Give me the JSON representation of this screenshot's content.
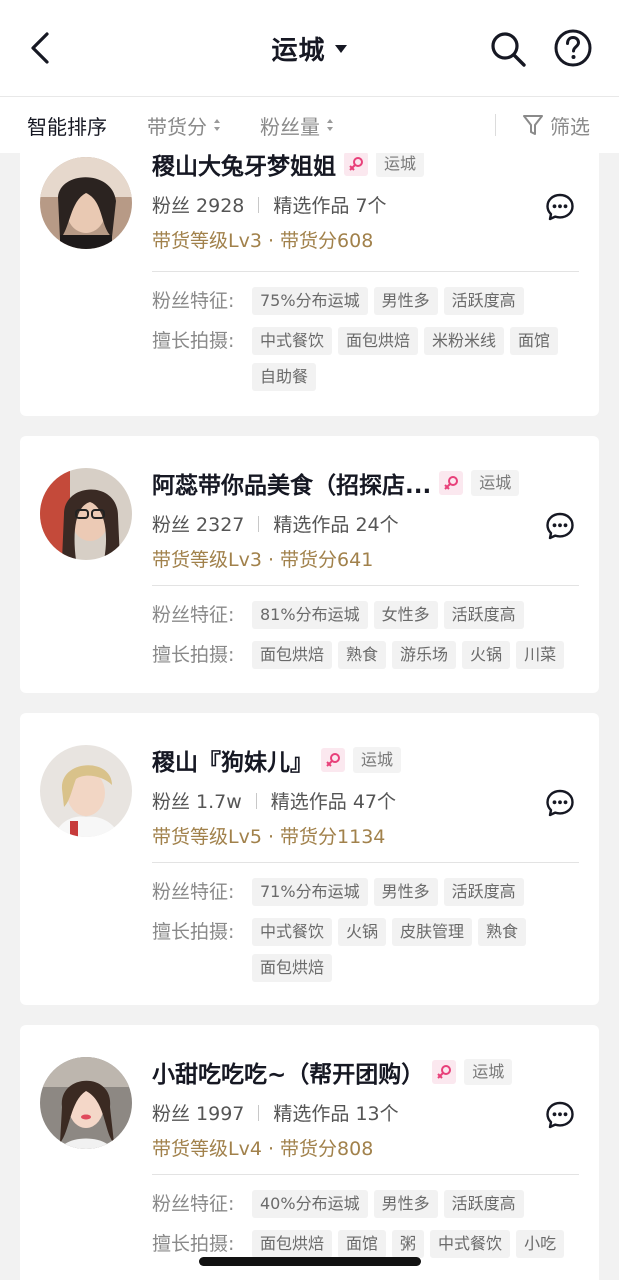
{
  "header": {
    "title": "运城"
  },
  "sortbar": {
    "smart": "智能排序",
    "goods_score": "带货分",
    "fans_count": "粉丝量",
    "filter": "筛选"
  },
  "cards": [
    {
      "name": "稷山大兔牙梦姐姐",
      "city": "运城",
      "fans": "粉丝 2928",
      "works": "精选作品 7个",
      "level": "带货等级Lv3 · 带货分608",
      "fans_label": "粉丝特征:",
      "fans_tags": [
        "75%分布运城",
        "男性多",
        "活跃度高"
      ],
      "skill_label": "擅长拍摄:",
      "skill_tags": [
        "中式餐饮",
        "面包烘焙",
        "米粉米线",
        "面馆",
        "自助餐"
      ]
    },
    {
      "name": "阿蕊带你品美食（招探店...",
      "city": "运城",
      "fans": "粉丝 2327",
      "works": "精选作品 24个",
      "level": "带货等级Lv3 · 带货分641",
      "fans_label": "粉丝特征:",
      "fans_tags": [
        "81%分布运城",
        "女性多",
        "活跃度高"
      ],
      "skill_label": "擅长拍摄:",
      "skill_tags": [
        "面包烘焙",
        "熟食",
        "游乐场",
        "火锅",
        "川菜"
      ]
    },
    {
      "name": "稷山『狗妹儿』",
      "city": "运城",
      "fans": "粉丝 1.7w",
      "works": "精选作品 47个",
      "level": "带货等级Lv5 · 带货分1134",
      "fans_label": "粉丝特征:",
      "fans_tags": [
        "71%分布运城",
        "男性多",
        "活跃度高"
      ],
      "skill_label": "擅长拍摄:",
      "skill_tags": [
        "中式餐饮",
        "火锅",
        "皮肤管理",
        "熟食",
        "面包烘焙"
      ]
    },
    {
      "name": "小甜吃吃吃~（帮开团购）",
      "city": "运城",
      "fans": "粉丝 1997",
      "works": "精选作品 13个",
      "level": "带货等级Lv4 · 带货分808",
      "fans_label": "粉丝特征:",
      "fans_tags": [
        "40%分布运城",
        "男性多",
        "活跃度高"
      ],
      "skill_label": "擅长拍摄:",
      "skill_tags": [
        "面包烘焙",
        "面馆",
        "粥",
        "中式餐饮",
        "小吃"
      ]
    }
  ],
  "colors": {
    "level_gold": "#a1814b",
    "gender_pink": "#e8407a"
  }
}
